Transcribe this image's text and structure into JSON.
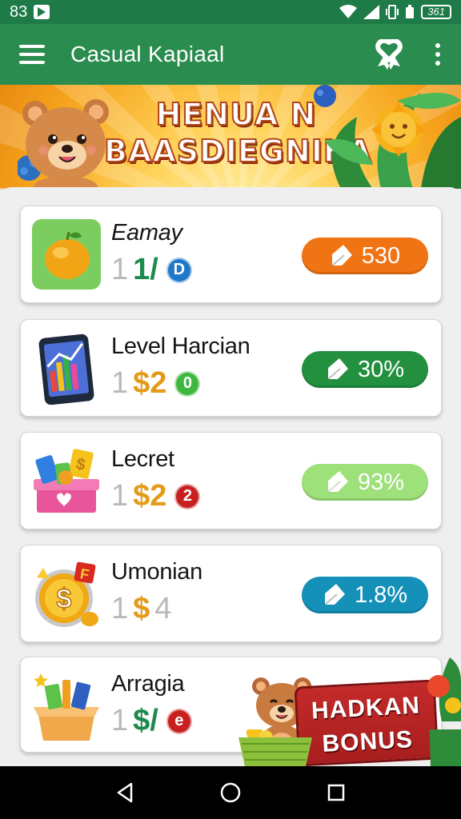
{
  "status_bar": {
    "time": "83",
    "battery": "361"
  },
  "app_bar": {
    "title": "Casual Kapiaal",
    "actions": [
      "ribbon-icon",
      "more-vert-icon"
    ]
  },
  "banner": {
    "title_line1": "HENUA N",
    "title_line2": "BAASDIEGNIKA"
  },
  "cards": [
    {
      "name": "Eamay",
      "stat_prefix": "1",
      "stat_main": "1/",
      "badge": "D",
      "badge_color": "#1f79c8",
      "pill": "530",
      "pill_color": "#f07314",
      "stat_style": "green"
    },
    {
      "name": "Level Harcian",
      "stat_prefix": "1",
      "stat_main": "$2",
      "badge": "0",
      "badge_color": "#3fb73f",
      "pill": "30%",
      "pill_color": "#22903f",
      "stat_style": "gold"
    },
    {
      "name": "Lecret",
      "stat_prefix": "1",
      "stat_main": "$2",
      "badge": "2",
      "badge_color": "#c82020",
      "pill": "93%",
      "pill_color": "#9ee07a",
      "stat_style": "gold"
    },
    {
      "name": "Umonian",
      "stat_prefix": "1",
      "stat_main": "$",
      "stat_tail": "4",
      "badge": "",
      "pill": "1.8%",
      "pill_color": "#1590b8",
      "stat_style": "gold"
    },
    {
      "name": "Arragia",
      "stat_prefix": "1",
      "stat_main": "$/",
      "badge": "e",
      "badge_color": "#c82020",
      "pill": "",
      "stat_style": "green"
    }
  ],
  "bonus": {
    "line1": "HADKAN",
    "line2": "BONUS"
  },
  "nav": [
    "back-icon",
    "home-icon",
    "recents-icon"
  ]
}
